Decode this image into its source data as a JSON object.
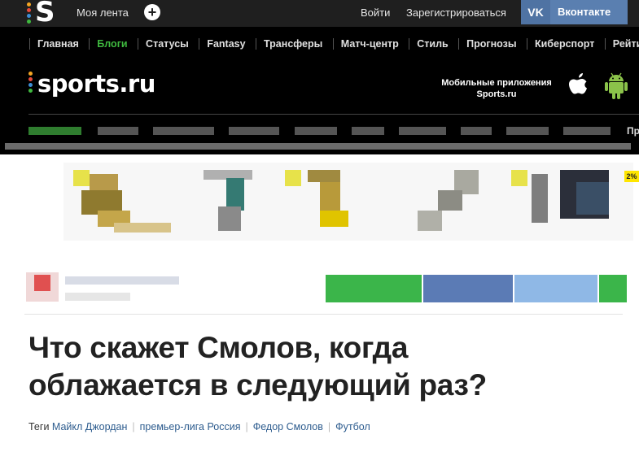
{
  "topbar": {
    "feed_label": "Моя лента",
    "plus_label": "+",
    "login_label": "Войти",
    "register_label": "Зарегистрироваться",
    "vk_icon_label": "VK",
    "vk_label": "Вконтакте"
  },
  "nav": {
    "items": [
      {
        "label": "Главная"
      },
      {
        "label": "Блоги",
        "active": true
      },
      {
        "label": "Статусы"
      },
      {
        "label": "Fantasy"
      },
      {
        "label": "Трансферы"
      },
      {
        "label": "Матч-центр"
      },
      {
        "label": "Стиль"
      },
      {
        "label": "Прогнозы"
      },
      {
        "label": "Киберспорт"
      },
      {
        "label": "Рейтинг"
      }
    ]
  },
  "brand": {
    "logo_text": "sports.ru",
    "apps_line1": "Мобильные приложения",
    "apps_line2": "Sports.ru",
    "truncated_nav": "Пр"
  },
  "ad": {
    "badge": "2%"
  },
  "article": {
    "title_line1": "Что скажет Смолов, когда",
    "title_line2": "облажается в следующий раз?",
    "tags_label": "Теги",
    "tags": [
      "Майкл Джордан",
      "премьер-лига Россия",
      "Федор Смолов",
      "Футбол"
    ]
  },
  "colors": {
    "topbar_bg": "#1f1f1f",
    "nav_bg": "#000000",
    "active_nav": "#3fb93f",
    "vk_blue": "#5a7fb0",
    "tag_link": "#2d5c8e",
    "headline": "#222222"
  }
}
